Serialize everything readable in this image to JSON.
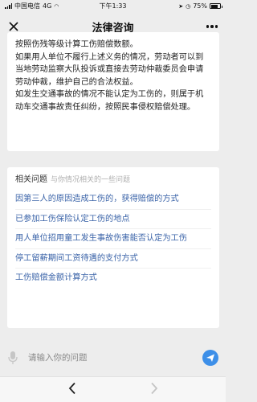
{
  "status": {
    "carrier": "中国电信",
    "network": "4G",
    "time": "下午1:33",
    "battery": "75%",
    "battery_level": 0.75
  },
  "nav": {
    "title": "法律咨询"
  },
  "answer": {
    "paragraphs": [
      "按照伤残等级计算工伤赔偿数额。",
      "如果用人单位不履行上述义务的情况，劳动者可以到当地劳动监察大队投诉或直接去劳动仲裁委员会申请劳动仲裁，维护自己的合法权益。",
      "如发生交通事故的情况不能认定为工伤的，则属于机动车交通事故责任纠纷，按照民事侵权赔偿处理。"
    ]
  },
  "related": {
    "title": "相关问题",
    "subtitle": "与你情况相关的一些问题",
    "items": [
      "因第三人的原因造成工伤的，获得赔偿的方式",
      "已参加工伤保险认定工伤的地点",
      "用人单位招用童工发生事故伤害能否认定为工伤",
      "停工留薪期间工资待遇的支付方式",
      "工伤赔偿金额计算方式"
    ]
  },
  "input": {
    "placeholder": "请输入你的问题"
  },
  "colors": {
    "link": "#3a63a8",
    "send": "#3d8fe8",
    "background": "#ededed"
  },
  "icons": {
    "close": "close-icon",
    "more": "more-icon",
    "mic": "microphone-icon",
    "send": "send-icon",
    "back": "back-arrow-icon",
    "forward": "forward-arrow-icon"
  }
}
